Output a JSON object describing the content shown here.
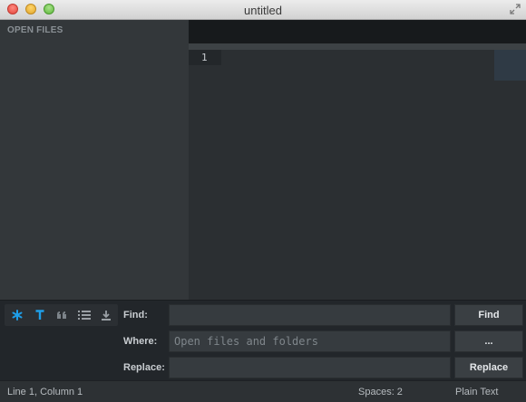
{
  "window": {
    "title": "untitled"
  },
  "sidebar": {
    "header": "OPEN FILES"
  },
  "editor": {
    "line_numbers": [
      "1"
    ]
  },
  "find_panel": {
    "options": [
      {
        "icon": "regex-icon",
        "active": true
      },
      {
        "icon": "case-sensitive-icon",
        "active": true
      },
      {
        "icon": "whole-word-icon",
        "active": false
      },
      {
        "icon": "list-icon",
        "active": false
      },
      {
        "icon": "download-icon",
        "active": false
      }
    ],
    "find_label": "Find:",
    "find_value": "",
    "where_label": "Where:",
    "where_placeholder": "Open files and folders",
    "replace_label": "Replace:",
    "replace_value": "",
    "find_button": "Find",
    "where_button": "...",
    "replace_button": "Replace"
  },
  "status_bar": {
    "position": "Line 1, Column 1",
    "indentation": "Spaces: 2",
    "syntax": "Plain Text"
  },
  "colors": {
    "accent": "#1e9ee8"
  }
}
